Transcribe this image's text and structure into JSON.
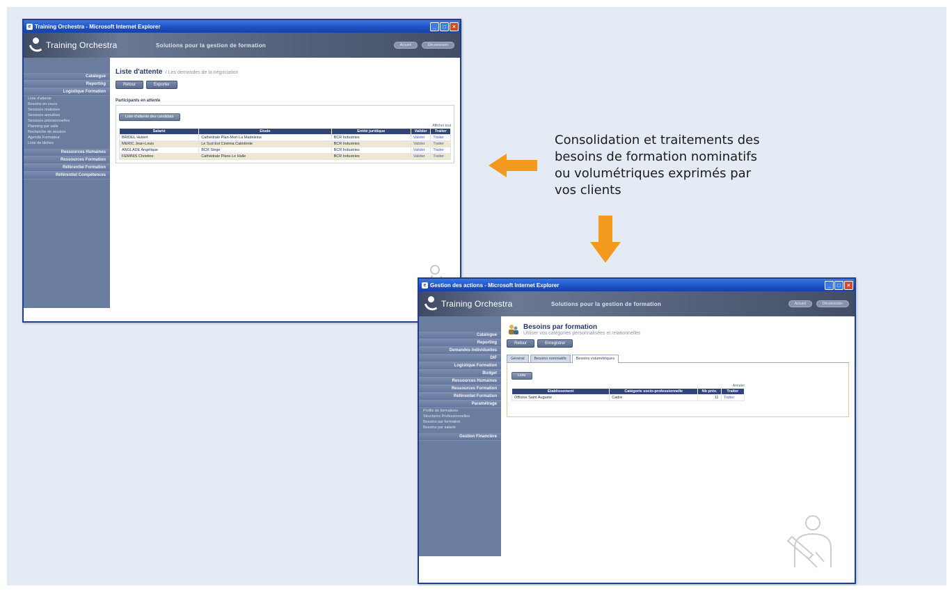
{
  "caption": {
    "lines": [
      "Consolidation et traitements des",
      "besoins de formation nominatifs",
      "ou volumétriques exprimés par",
      "vos clients"
    ]
  },
  "colors": {
    "arrow": "#f39a1e",
    "sidebar": "#6b7d9e",
    "table_header": "#2f4676"
  },
  "window1": {
    "title": "Training Orchestra - Microsoft Internet Explorer",
    "logo_text": "Training Orchestra",
    "tagline": "Solutions pour la gestion de formation",
    "header_buttons": [
      "Accueil",
      "Déconnexion"
    ],
    "sidebar": [
      {
        "label": "Catalogue",
        "sub": []
      },
      {
        "label": "Reporting",
        "sub": []
      },
      {
        "label": "Logistique Formation",
        "sub": [
          "Liste d'attente",
          "Besoins en cours",
          "Sessions réalisées",
          "Sessions annulées",
          "Sessions prévisionnelles",
          "Planning par salle",
          "Recherche de session",
          "Agenda Formateur",
          "Liste de tâches"
        ]
      },
      {
        "label": "Ressources Humaines",
        "sub": []
      },
      {
        "label": "Ressources Formation",
        "sub": []
      },
      {
        "label": "Référentiel Formation",
        "sub": []
      },
      {
        "label": "Référentiel Compétences",
        "sub": []
      }
    ],
    "page_title": "Liste d'attente",
    "page_subtitle": "/ Les demandes de la négociation",
    "buttons": [
      "Retour",
      "Exporter"
    ],
    "section_label": "Participants en attente",
    "panel_button": "Liste d'attente des candidats",
    "panel_link": "Afficher tout",
    "table": {
      "headers": [
        "Salarié",
        "Etude",
        "Entité juridique",
        "Valider",
        "Traiter"
      ],
      "rows": [
        [
          "BRIDEL Hubert",
          "Cathédrale Plan-Mort La Madeleine",
          "BCR Industries",
          "Valider",
          "Traiter"
        ],
        [
          "MERIC Jean-Louis",
          "Le Sud Est Cinéma Calédonie",
          "BCR Industries",
          "Valider",
          "Traiter"
        ],
        [
          "ANGLADE Angélique",
          "BCR Siège",
          "BCR Industries",
          "Valider",
          "Traiter"
        ],
        [
          "FEMINIS Christine",
          "Cathédrale Plans Le Halle",
          "BCR Industries",
          "Valider",
          "Traiter"
        ]
      ]
    }
  },
  "window2": {
    "title": "Gestion des actions - Microsoft Internet Explorer",
    "logo_text": "Training Orchestra",
    "tagline": "Solutions pour la gestion de formation",
    "header_buttons": [
      "Accueil",
      "Déconnexion"
    ],
    "sidebar": [
      {
        "label": "Catalogue",
        "sub": []
      },
      {
        "label": "Reporting",
        "sub": []
      },
      {
        "label": "Demandes Individuelles",
        "sub": []
      },
      {
        "label": "DIF",
        "sub": []
      },
      {
        "label": "Logistique Formation",
        "sub": []
      },
      {
        "label": "Budget",
        "sub": []
      },
      {
        "label": "Ressources Humaines",
        "sub": []
      },
      {
        "label": "Ressources Formation",
        "sub": []
      },
      {
        "label": "Référentiel Formation",
        "sub": []
      },
      {
        "label": "Paramétrage",
        "sub": [
          "Profils de formations",
          "Structures Professionnelles",
          "Besoins par formation",
          "Besoins par salarié"
        ]
      },
      {
        "label": "Gestion Financière",
        "sub": []
      }
    ],
    "page_title": "Besoins par formation",
    "page_subtitle": "Utiliser vos catégories personnalisées et relationnelles",
    "buttons": [
      "Retour",
      "Enregistrer"
    ],
    "tabs": [
      "Général",
      "Besoins nominatifs",
      "Besoins volumétriques"
    ],
    "active_tab": 2,
    "panel_button": "Liste",
    "table": {
      "header_note": "Annuler",
      "headers": [
        "Etablissement",
        "Catégorie socio-professionnelle",
        "Nb prév.",
        "Traiter"
      ],
      "rows": [
        [
          "Officine Saint Auguste",
          "Cadre",
          "11",
          "Traiter"
        ]
      ]
    }
  }
}
